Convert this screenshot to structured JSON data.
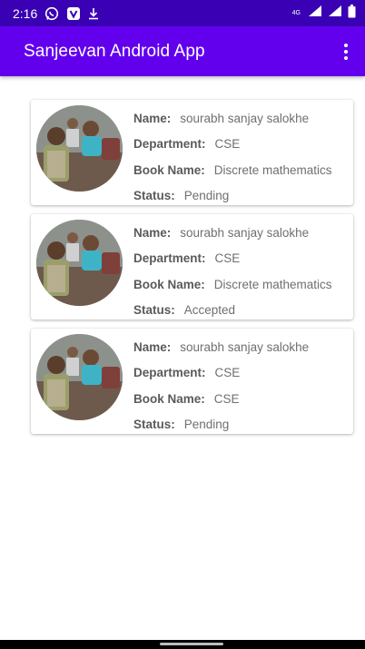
{
  "status_bar": {
    "time": "2:16",
    "network_label": "4G",
    "icons": [
      "whatsapp-icon",
      "v-app-icon",
      "download-icon",
      "signal-icon",
      "signal-icon",
      "battery-icon"
    ]
  },
  "app_bar": {
    "title": "Sanjeevan Android App",
    "menu_icon": "more-vert-icon"
  },
  "labels": {
    "name": "Name:",
    "department": "Department:",
    "book_name": "Book Name:",
    "status": "Status:"
  },
  "requests": [
    {
      "name": "sourabh sanjay salokhe",
      "department": "CSE",
      "book_name": "Discrete mathematics",
      "status": "Pending"
    },
    {
      "name": "sourabh sanjay salokhe",
      "department": "CSE",
      "book_name": "Discrete mathematics",
      "status": "Accepted"
    },
    {
      "name": "sourabh sanjay salokhe",
      "department": "CSE",
      "book_name": "CSE",
      "status": "Pending"
    }
  ],
  "colors": {
    "status_bar": "#3a00b3",
    "app_bar": "#6200ee",
    "label_text": "#5a5a5a",
    "value_text": "#6f6f6f"
  }
}
